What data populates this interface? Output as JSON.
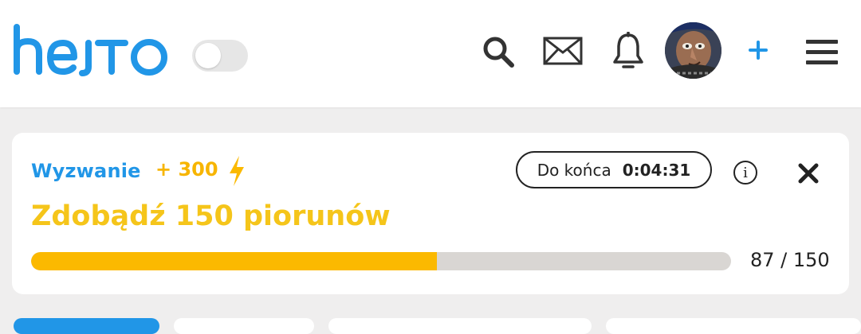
{
  "header": {
    "logo_text": "hejto",
    "brand_color": "#2196e7",
    "toggle_on": false,
    "icons": [
      "search-icon",
      "mail-icon",
      "bell-icon",
      "avatar",
      "plus-icon",
      "menu-icon"
    ],
    "plus_label": "+"
  },
  "challenge": {
    "label": "Wyzwanie",
    "points": "+ 300",
    "timer_label": "Do końca",
    "timer_value": "0:04:31",
    "info_symbol": "i",
    "title": "Zdobądź 150 piorunów",
    "progress_current": 87,
    "progress_total": 150,
    "progress_text": "87 / 150",
    "accent_color": "#fbb900",
    "title_color": "#f5c51a"
  },
  "tabs": [
    {
      "active": true
    },
    {
      "active": false
    },
    {
      "active": false
    },
    {
      "active": false
    }
  ]
}
